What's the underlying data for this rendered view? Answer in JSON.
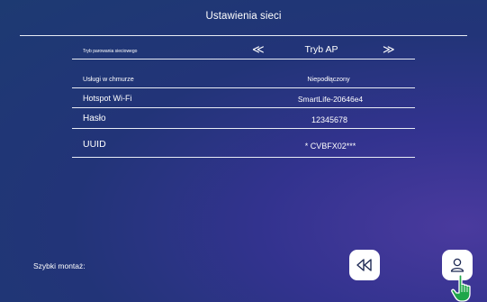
{
  "header": {
    "title": "Ustawienia sieci"
  },
  "rows": [
    {
      "label": "Tryb parowania sieciowego",
      "value": "Tryb AP",
      "prev_arrow": "≪",
      "next_arrow": "≫"
    },
    {
      "label": "Usługi w chmurze",
      "value": "Niepodłączony"
    },
    {
      "label": "Hotspot Wi-Fi",
      "value": "SmartLife-20646e4"
    },
    {
      "label": "Hasło",
      "value": "12345678"
    },
    {
      "label": "UUID",
      "value": "* CVBFX02***"
    }
  ],
  "footer": {
    "label": "Szybki montaż:"
  },
  "icons": {
    "prev_icon": "double-chevron-left-icon",
    "next_icon": "double-chevron-right-icon",
    "back_icon": "rewind-icon",
    "user_icon": "user-icon",
    "cursor_icon": "hand-pointer-icon"
  },
  "colors": {
    "background": "#223478",
    "accent": "#4a3a9e",
    "cursor": "#1fa64a"
  }
}
